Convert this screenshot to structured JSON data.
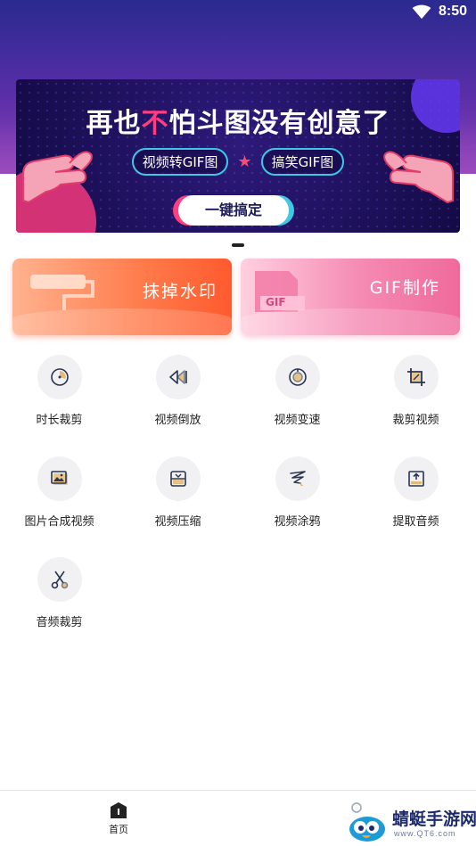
{
  "status_bar": {
    "time": "8:50"
  },
  "banner": {
    "title_before": "再也",
    "title_highlight": "不",
    "title_after": "怕斗图没有创意了",
    "tag_left": "视频转GIF图",
    "tag_right": "搞笑GIF图",
    "button": "一键搞定"
  },
  "cards": {
    "watermark": {
      "label": "抹掉水印"
    },
    "gif": {
      "label": "GIF制作",
      "file_badge": "GIF"
    }
  },
  "tools": [
    {
      "label": "时长裁剪",
      "icon": "clock-icon"
    },
    {
      "label": "视频倒放",
      "icon": "rewind-icon"
    },
    {
      "label": "视频变速",
      "icon": "speed-icon"
    },
    {
      "label": "裁剪视频",
      "icon": "crop-icon"
    },
    {
      "label": "图片合成视频",
      "icon": "image-icon"
    },
    {
      "label": "视频压缩",
      "icon": "compress-icon"
    },
    {
      "label": "视频涂鸦",
      "icon": "doodle-icon"
    },
    {
      "label": "提取音频",
      "icon": "extract-audio-icon"
    },
    {
      "label": "音频裁剪",
      "icon": "scissors-icon"
    }
  ],
  "bottom_nav": {
    "home_label": "首页"
  },
  "site_watermark": {
    "name": "蜻蜓手游网",
    "url": "www.QT6.com"
  },
  "colors": {
    "accent_pink": "#ff3d7f",
    "accent_cyan": "#41c7e6",
    "icon_gold": "#e0a33a",
    "icon_dark": "#2b3550"
  }
}
